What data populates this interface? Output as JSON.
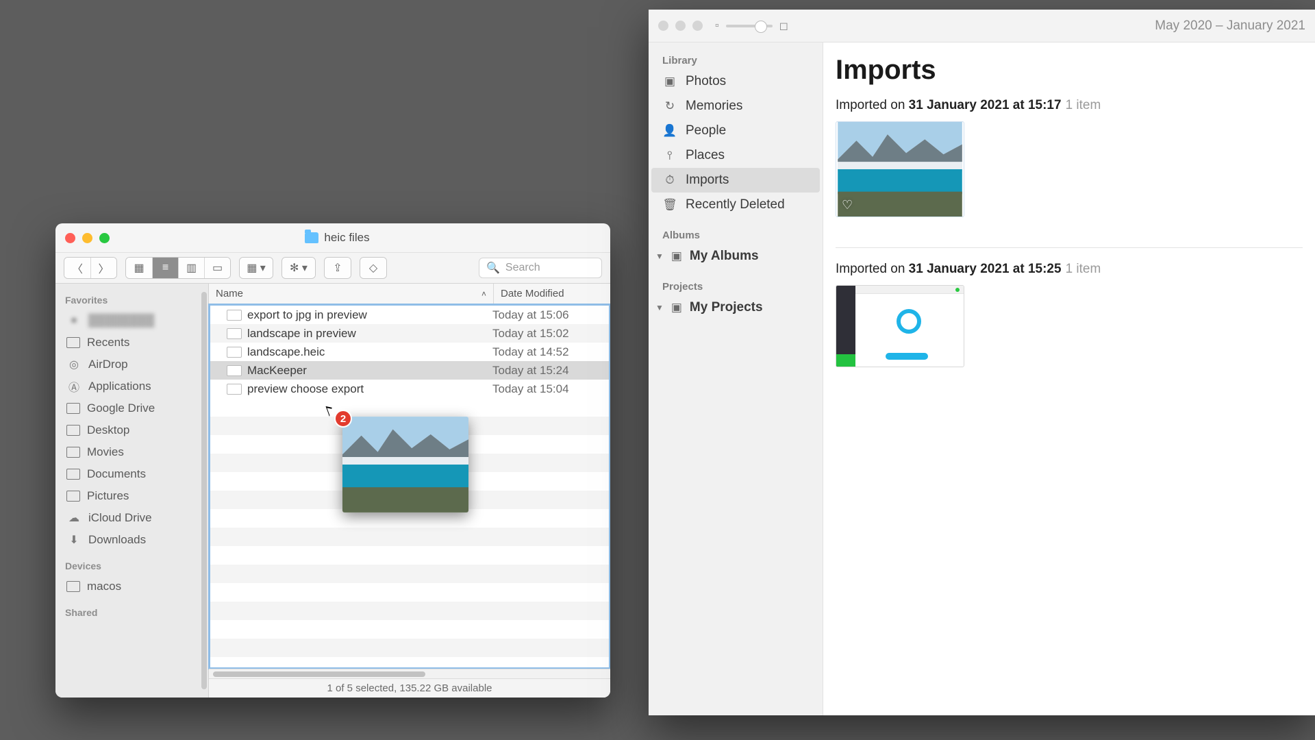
{
  "finder": {
    "title": "heic files",
    "search_placeholder": "Search",
    "sidebar": {
      "favorites_label": "Favorites",
      "devices_label": "Devices",
      "shared_label": "Shared",
      "items": [
        {
          "label": "Recents"
        },
        {
          "label": "AirDrop"
        },
        {
          "label": "Applications"
        },
        {
          "label": "Google Drive"
        },
        {
          "label": "Desktop"
        },
        {
          "label": "Movies"
        },
        {
          "label": "Documents"
        },
        {
          "label": "Pictures"
        },
        {
          "label": "iCloud Drive"
        },
        {
          "label": "Downloads"
        }
      ],
      "devices": [
        {
          "label": "macos"
        }
      ]
    },
    "columns": {
      "name": "Name",
      "date": "Date Modified"
    },
    "files": [
      {
        "name": "export to jpg in preview",
        "date": "Today at 15:06"
      },
      {
        "name": "landscape in preview",
        "date": "Today at 15:02"
      },
      {
        "name": "landscape.heic",
        "date": "Today at 14:52"
      },
      {
        "name": "MacKeeper",
        "date": "Today at 15:24",
        "selected": true
      },
      {
        "name": "preview choose export",
        "date": "Today at 15:04"
      }
    ],
    "status": "1 of 5 selected, 135.22 GB available",
    "drag_badge": "2"
  },
  "photos": {
    "date_range": "May 2020 – January 2021",
    "sidebar": {
      "library_label": "Library",
      "albums_label": "Albums",
      "projects_label": "Projects",
      "library": [
        {
          "label": "Photos"
        },
        {
          "label": "Memories"
        },
        {
          "label": "People"
        },
        {
          "label": "Places"
        },
        {
          "label": "Imports",
          "selected": true
        },
        {
          "label": "Recently Deleted"
        }
      ],
      "my_albums": "My Albums",
      "my_projects": "My Projects"
    },
    "main": {
      "title": "Imports",
      "groups": [
        {
          "prefix": "Imported on ",
          "bold": "31 January 2021 at 15:17",
          "count": "1 item"
        },
        {
          "prefix": "Imported on ",
          "bold": "31 January 2021 at 15:25",
          "count": "1 item"
        }
      ]
    }
  }
}
